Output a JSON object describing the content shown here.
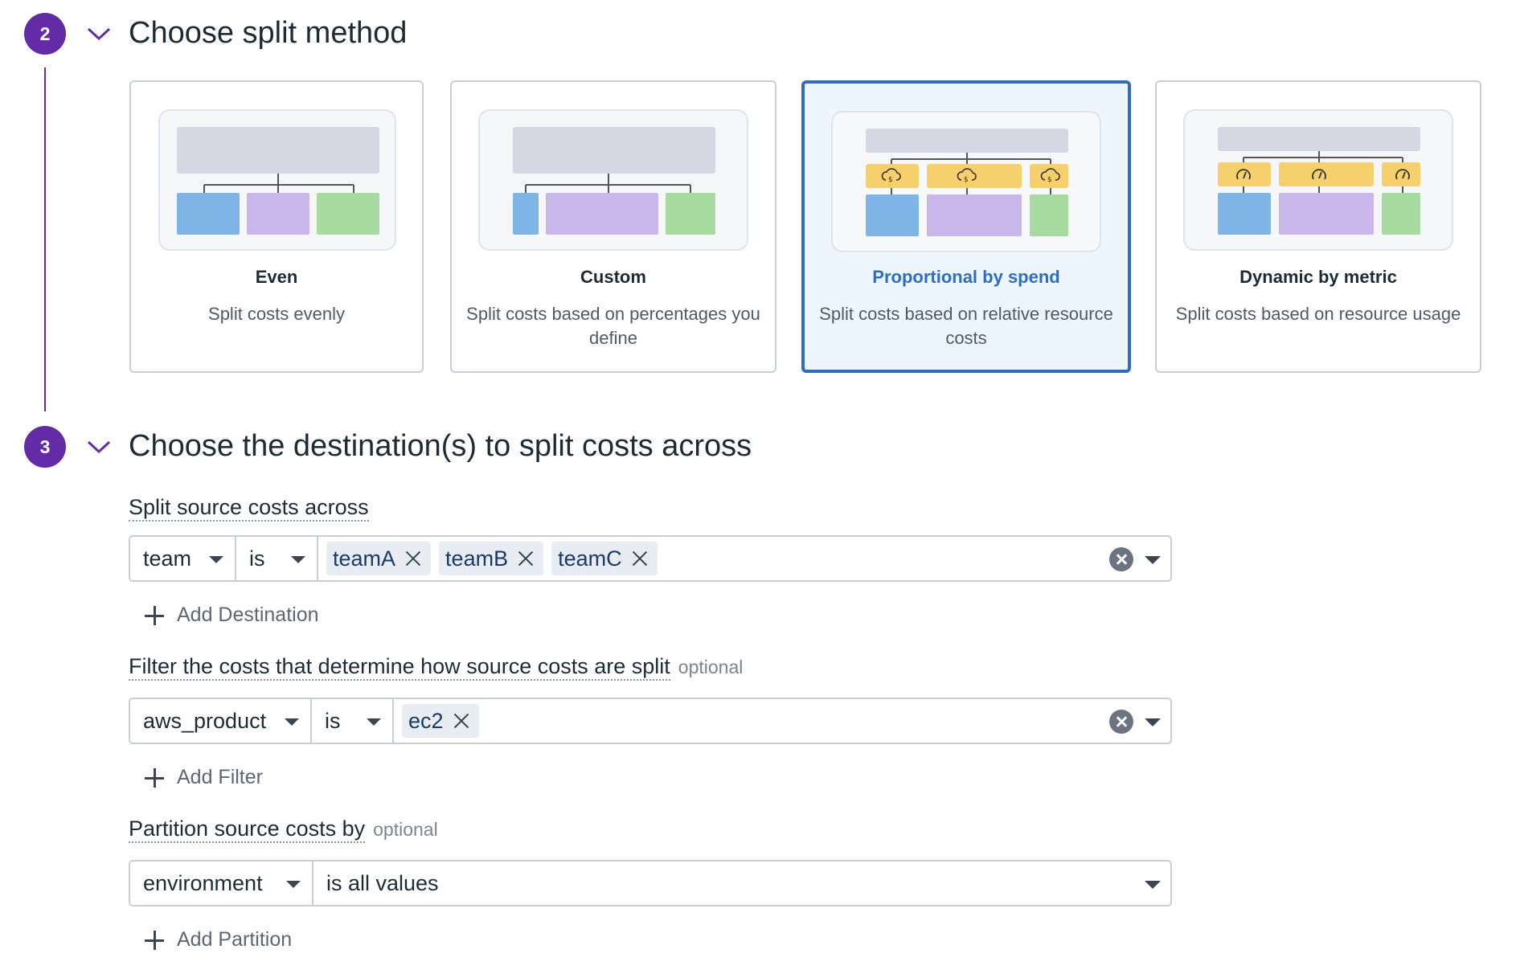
{
  "step2": {
    "number": "2",
    "title": "Choose split method",
    "cards": [
      {
        "title": "Even",
        "description": "Split costs evenly"
      },
      {
        "title": "Custom",
        "description": "Split costs based on percentages you define"
      },
      {
        "title": "Proportional by spend",
        "description": "Split costs based on relative resource costs",
        "selected": true
      },
      {
        "title": "Dynamic by metric",
        "description": "Split costs based on resource usage"
      }
    ]
  },
  "step3": {
    "number": "3",
    "title": "Choose the destination(s) to split costs across",
    "destination": {
      "label": "Split source costs across",
      "key": "team",
      "operator": "is",
      "values": [
        "teamA",
        "teamB",
        "teamC"
      ],
      "add_label": "Add Destination"
    },
    "filter": {
      "label": "Filter the costs that determine how source costs are split",
      "optional": "optional",
      "key": "aws_product",
      "operator": "is",
      "values": [
        "ec2"
      ],
      "add_label": "Add Filter"
    },
    "partition": {
      "label": "Partition source costs by",
      "optional": "optional",
      "key": "environment",
      "value": "is all values",
      "add_label": "Add Partition"
    }
  },
  "colors": {
    "accent": "#632ca6",
    "selected": "#2e6ec2",
    "block_blue": "#7fb5e6",
    "block_purple": "#c9b7ec",
    "block_green": "#a7dba0",
    "block_yellow": "#f7d06e",
    "block_gray": "#d5d8e3"
  },
  "icons": [
    "chevron-down-icon",
    "dollar-cloud-icon",
    "gauge-icon",
    "clear-icon",
    "close-icon",
    "plus-icon",
    "caret-down-icon"
  ]
}
